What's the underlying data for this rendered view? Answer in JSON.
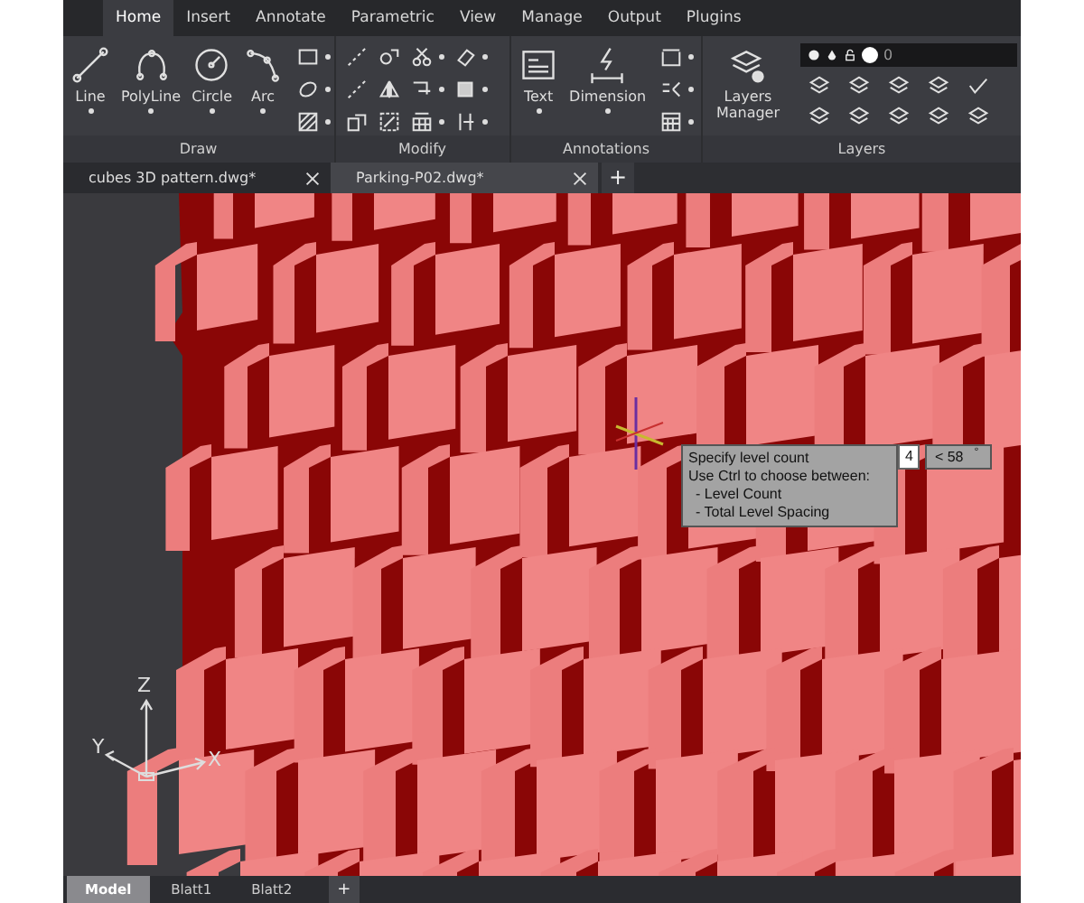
{
  "ribbon_tabs": [
    {
      "label": "Home",
      "selected": true
    },
    {
      "label": "Insert",
      "selected": false
    },
    {
      "label": "Annotate",
      "selected": false
    },
    {
      "label": "Parametric",
      "selected": false
    },
    {
      "label": "View",
      "selected": false
    },
    {
      "label": "Manage",
      "selected": false
    },
    {
      "label": "Output",
      "selected": false
    },
    {
      "label": "Plugins",
      "selected": false
    }
  ],
  "panels": [
    {
      "kind": "draw",
      "title": "Draw",
      "tools": [
        {
          "label": "Line"
        },
        {
          "label": "PolyLine"
        },
        {
          "label": "Circle"
        },
        {
          "label": "Arc"
        }
      ]
    },
    {
      "kind": "modify",
      "title": "Modify"
    },
    {
      "kind": "annotations",
      "title": "Annotations",
      "tools": [
        {
          "label": "Text"
        },
        {
          "label": "Dimension"
        }
      ]
    },
    {
      "kind": "layers",
      "title": "Layers",
      "tools": [
        {
          "label": "Layers Manager"
        }
      ],
      "layer_dropdown": {
        "value": "0"
      }
    }
  ],
  "document_tabs": [
    {
      "label": "cubes 3D pattern.dwg*",
      "selected": false
    },
    {
      "label": "Parking-P02.dwg*",
      "selected": true
    }
  ],
  "new_tab_button": "+",
  "tooltip": {
    "lines": [
      {
        "kind": "plain",
        "text": "Specify level count"
      },
      {
        "kind": "plain",
        "text": "Use Ctrl to choose between:"
      },
      {
        "kind": "bullet",
        "text": "- Level Count"
      },
      {
        "kind": "bullet",
        "text": "- Total Level Spacing"
      }
    ]
  },
  "dynamic_input": {
    "value": "4",
    "angle": "< 58",
    "unit": "°"
  },
  "ucs_icon": {
    "z": "Z",
    "y": "Y",
    "x": "X"
  },
  "layout_tabs": [
    {
      "label": "Model",
      "selected": true
    },
    {
      "label": "Blatt1",
      "selected": false
    },
    {
      "label": "Blatt2",
      "selected": false
    }
  ],
  "add_layout_button": "+"
}
